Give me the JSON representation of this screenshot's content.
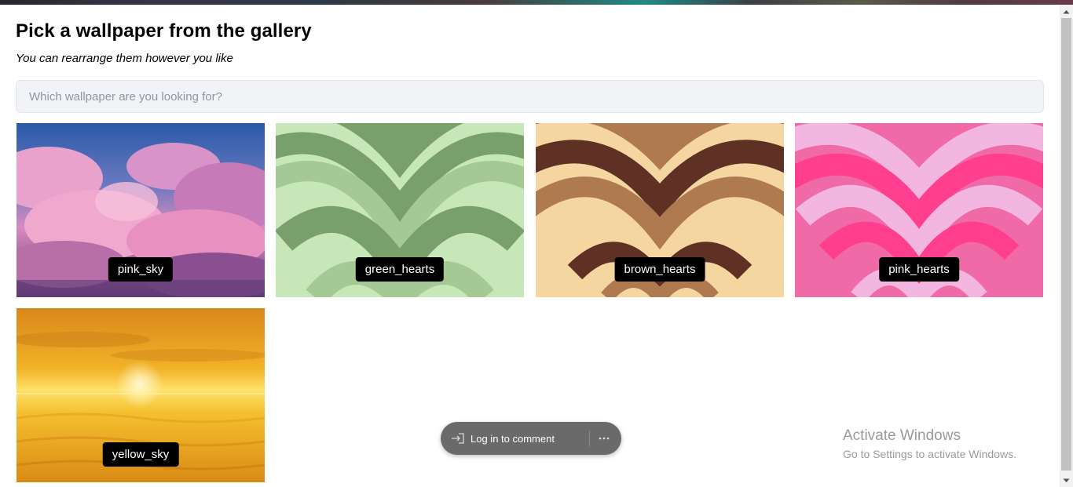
{
  "header": {
    "title": "Pick a wallpaper from the gallery",
    "subtitle": "You can rearrange them however you like"
  },
  "search": {
    "placeholder": "Which wallpaper are you looking for?",
    "value": ""
  },
  "gallery": {
    "items": [
      {
        "label": "pink_sky"
      },
      {
        "label": "green_hearts"
      },
      {
        "label": "brown_hearts"
      },
      {
        "label": "pink_hearts"
      },
      {
        "label": "yellow_sky"
      }
    ]
  },
  "comment_bar": {
    "login_label": "Log in to comment",
    "login_icon": "login-icon",
    "more_icon": "more-icon"
  },
  "watermark": {
    "line1": "Activate Windows",
    "line2": "Go to Settings to activate Windows."
  },
  "colors": {
    "label_bg": "#000000",
    "search_bg": "#f1f3f7",
    "pill_bg": "#6a6a6a"
  }
}
